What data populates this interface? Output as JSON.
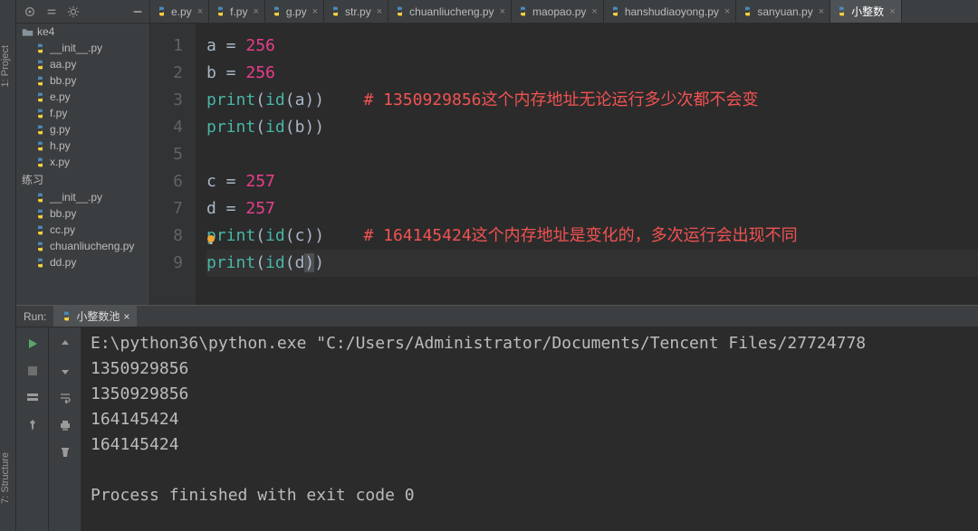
{
  "vertical_tabs": {
    "project": "1: Project",
    "structure": "7: Structure"
  },
  "tree": {
    "root_folder": "ke4",
    "items": [
      {
        "name": "__init__.py"
      },
      {
        "name": "aa.py"
      },
      {
        "name": "bb.py"
      },
      {
        "name": "e.py"
      },
      {
        "name": "f.py"
      },
      {
        "name": "g.py"
      },
      {
        "name": "h.py"
      },
      {
        "name": "x.py"
      }
    ],
    "folder2": "练习",
    "items2": [
      {
        "name": "__init__.py"
      },
      {
        "name": "bb.py"
      },
      {
        "name": "cc.py"
      },
      {
        "name": "chuanliucheng.py"
      },
      {
        "name": "dd.py"
      }
    ]
  },
  "tabs": [
    {
      "label": "e.py",
      "selected": false
    },
    {
      "label": "f.py",
      "selected": false
    },
    {
      "label": "g.py",
      "selected": false
    },
    {
      "label": "str.py",
      "selected": false
    },
    {
      "label": "chuanliucheng.py",
      "selected": false
    },
    {
      "label": "maopao.py",
      "selected": false
    },
    {
      "label": "hanshudiaoyong.py",
      "selected": false
    },
    {
      "label": "sanyuan.py",
      "selected": false
    },
    {
      "label": "小整数",
      "selected": true
    }
  ],
  "code": {
    "lines": [
      "1",
      "2",
      "3",
      "4",
      "5",
      "6",
      "7",
      "8",
      "9"
    ],
    "l1": {
      "v": "a",
      "eq": " = ",
      "n": "256"
    },
    "l2": {
      "v": "b",
      "eq": " = ",
      "n": "256"
    },
    "l3": {
      "fn": "print",
      "op": "(",
      "bi": "id",
      "op2": "(",
      "arg": "a",
      "cp": ")",
      "comment": "# 1350929856这个内存地址无论运行多少次都不会变"
    },
    "l4": {
      "fn": "print",
      "op": "(",
      "bi": "id",
      "op2": "(",
      "arg": "b",
      "cp": ")"
    },
    "l6": {
      "v": "c",
      "eq": " = ",
      "n": "257"
    },
    "l7": {
      "v": "d",
      "eq": " = ",
      "n": "257"
    },
    "l8": {
      "fn": "print",
      "op": "(",
      "bi": "id",
      "op2": "(",
      "arg": "c",
      "cp": ")",
      "comment": "# 164145424这个内存地址是变化的，多次运行会出现不同"
    },
    "l9": {
      "fn": "print",
      "op": "(",
      "bi": "id",
      "op2": "(",
      "arg": "d",
      "cp": ")"
    }
  },
  "run": {
    "label": "Run:",
    "tab": "小整数池",
    "console_lines": [
      "E:\\python36\\python.exe \"C:/Users/Administrator/Documents/Tencent Files/27724778",
      "1350929856",
      "1350929856",
      "164145424",
      "164145424",
      "",
      "Process finished with exit code 0"
    ]
  }
}
